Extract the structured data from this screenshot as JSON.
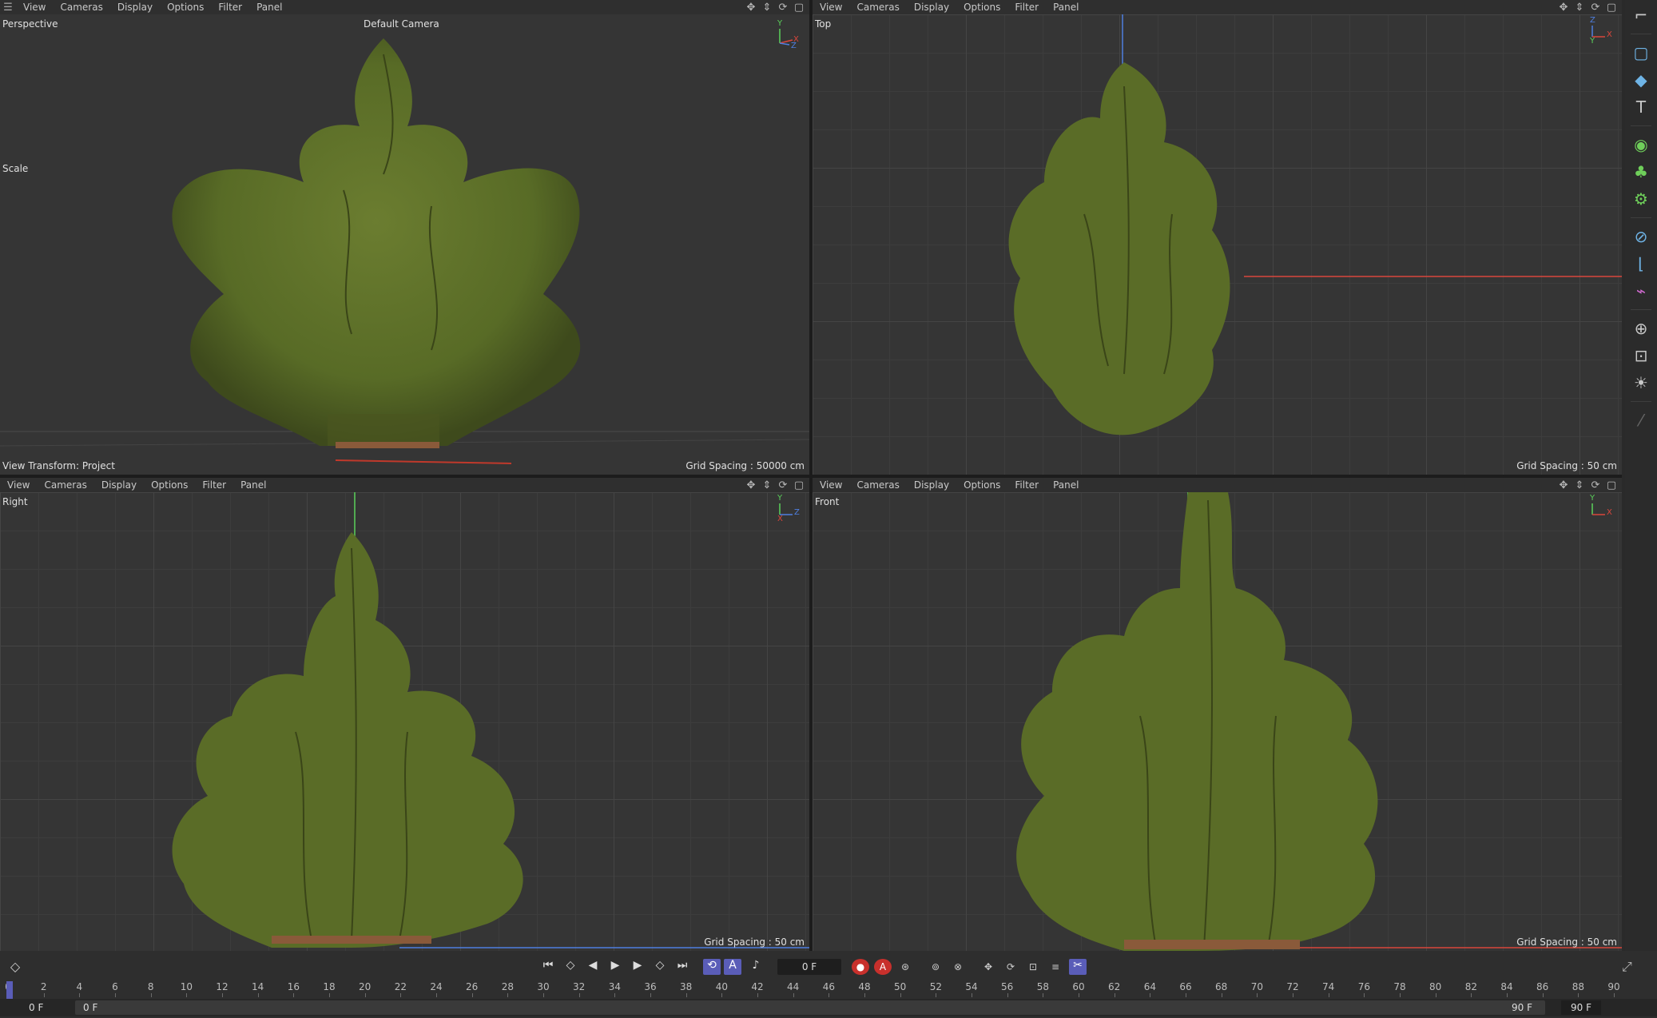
{
  "menus": [
    "View",
    "Cameras",
    "Display",
    "Options",
    "Filter",
    "Panel"
  ],
  "nav_icons": [
    "move-view-icon",
    "pan-view-icon",
    "rotate-view-icon",
    "maximize-view-icon"
  ],
  "viewports": {
    "perspective": {
      "label": "Perspective",
      "camera": "Default Camera",
      "scale": "Scale",
      "view_transform": "View Transform: Project",
      "grid_spacing": "Grid Spacing : 50000 cm"
    },
    "top": {
      "label": "Top",
      "grid_spacing": "Grid Spacing : 50 cm"
    },
    "right": {
      "label": "Right",
      "grid_spacing": "Grid Spacing : 50 cm"
    },
    "front": {
      "label": "Front",
      "grid_spacing": "Grid Spacing : 50 cm"
    }
  },
  "axis_labels": {
    "x": "X",
    "y": "Y",
    "z": "Z"
  },
  "colors": {
    "x_axis": "#d9463c",
    "y_axis": "#5bd15b",
    "z_axis": "#4f7fe0",
    "foliage_dark": "#4a5a22",
    "foliage_light": "#7a8a3a",
    "accent": "#5a5db8"
  },
  "toolbar_icons": [
    "layout-icon",
    "cube-icon",
    "cube-solid-icon",
    "text-icon",
    "generator-icon",
    "cloner-icon",
    "gear-icon",
    "deformer-icon",
    "selection-icon",
    "spline-icon",
    "scene-icon",
    "camera-icon",
    "light-icon",
    "brush-icon"
  ],
  "timeline": {
    "current_frame": "0 F",
    "start_frame": "0 F",
    "min_frame": "0 F",
    "end_frame": "90 F",
    "max_frame": "90 F",
    "ticks": [
      "0",
      "2",
      "4",
      "6",
      "8",
      "10",
      "12",
      "14",
      "16",
      "18",
      "20",
      "22",
      "24",
      "26",
      "28",
      "30",
      "32",
      "34",
      "36",
      "38",
      "40",
      "42",
      "44",
      "46",
      "48",
      "50",
      "52",
      "54",
      "56",
      "58",
      "60",
      "62",
      "64",
      "66",
      "68",
      "70",
      "72",
      "74",
      "76",
      "78",
      "80",
      "82",
      "84",
      "86",
      "88",
      "90"
    ]
  }
}
